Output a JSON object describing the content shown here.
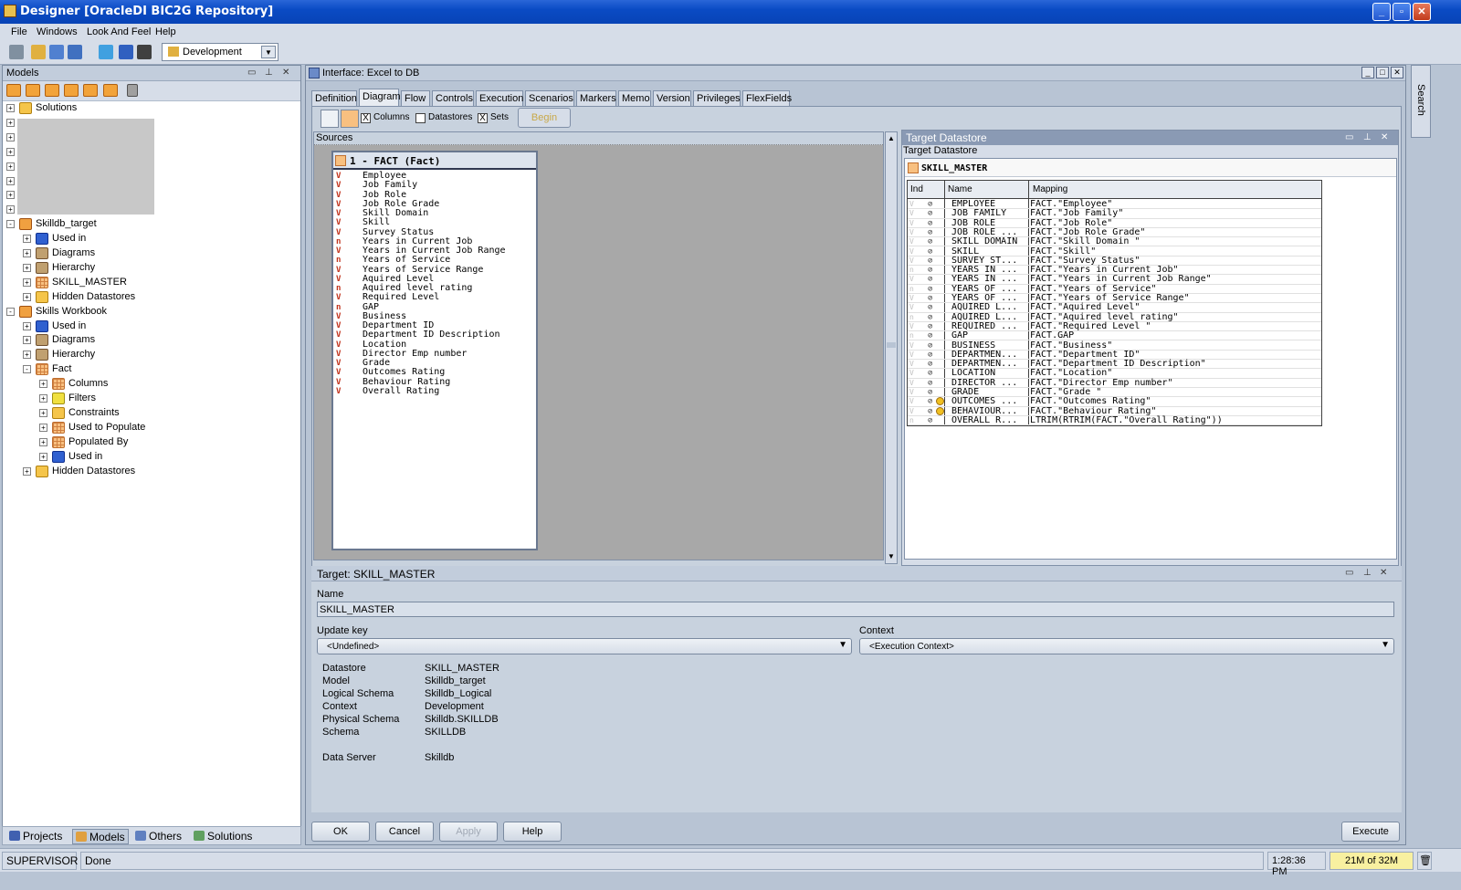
{
  "app": {
    "title": "Designer [OracleDI BIC2G Repository]",
    "window_controls": [
      "_",
      "▫",
      "✕"
    ]
  },
  "menubar": [
    "File",
    "Windows",
    "Look And Feel",
    "Help"
  ],
  "toolbar": {
    "context_combo": "Development"
  },
  "left_panel": {
    "title": "Models",
    "tree": [
      {
        "label": "Solutions",
        "level": 0,
        "icon": "folder-icon",
        "exp": "+"
      },
      {
        "label": "",
        "level": 0,
        "icon": "",
        "exp": "+"
      },
      {
        "label": "",
        "level": 0,
        "icon": "",
        "exp": "+"
      },
      {
        "label": "",
        "level": 0,
        "icon": "",
        "exp": "+"
      },
      {
        "label": "",
        "level": 0,
        "icon": "",
        "exp": "+"
      },
      {
        "label": "",
        "level": 0,
        "icon": "",
        "exp": "+"
      },
      {
        "label": "",
        "level": 0,
        "icon": "",
        "exp": "+"
      },
      {
        "label": "",
        "level": 0,
        "icon": "",
        "exp": "+"
      },
      {
        "label": "Skilldb_target",
        "level": 0,
        "icon": "model-icon",
        "exp": "-"
      },
      {
        "label": "Used in",
        "level": 1,
        "icon": "used-in-icon",
        "exp": "+"
      },
      {
        "label": "Diagrams",
        "level": 1,
        "icon": "diagrams-icon",
        "exp": "+"
      },
      {
        "label": "Hierarchy",
        "level": 1,
        "icon": "hierarchy-icon",
        "exp": "+"
      },
      {
        "label": "SKILL_MASTER",
        "level": 1,
        "icon": "datastore-icon",
        "exp": "+"
      },
      {
        "label": "Hidden Datastores",
        "level": 1,
        "icon": "folder-icon",
        "exp": "+"
      },
      {
        "label": "Skills Workbook",
        "level": 0,
        "icon": "model-icon",
        "exp": "-"
      },
      {
        "label": "Used in",
        "level": 1,
        "icon": "used-in-icon",
        "exp": "+"
      },
      {
        "label": "Diagrams",
        "level": 1,
        "icon": "diagrams-icon",
        "exp": "+"
      },
      {
        "label": "Hierarchy",
        "level": 1,
        "icon": "hierarchy-icon",
        "exp": "+"
      },
      {
        "label": "Fact",
        "level": 1,
        "icon": "datastore-icon",
        "exp": "-"
      },
      {
        "label": "Columns",
        "level": 2,
        "icon": "columns-icon",
        "exp": "+"
      },
      {
        "label": "Filters",
        "level": 2,
        "icon": "filter-icon",
        "exp": "+"
      },
      {
        "label": "Constraints",
        "level": 2,
        "icon": "constraints-icon",
        "exp": "+"
      },
      {
        "label": "Used to Populate",
        "level": 2,
        "icon": "datastore-icon",
        "exp": "+"
      },
      {
        "label": "Populated By",
        "level": 2,
        "icon": "datastore-icon",
        "exp": "+"
      },
      {
        "label": "Used in",
        "level": 2,
        "icon": "used-in-icon",
        "exp": "+"
      },
      {
        "label": "Hidden Datastores",
        "level": 1,
        "icon": "folder-icon",
        "exp": "+"
      }
    ],
    "bottom_tabs": [
      "Projects",
      "Models",
      "Others",
      "Solutions"
    ]
  },
  "interface": {
    "title": "Interface: Excel to DB",
    "tabs": [
      "Definition",
      "Diagram",
      "Flow",
      "Controls",
      "Execution",
      "Scenarios",
      "Markers",
      "Memo",
      "Version",
      "Privileges",
      "FlexFields"
    ],
    "active_tab": "Diagram",
    "diagram_toolbar": {
      "columns_label": "Columns",
      "datastores_label": "Datastores",
      "sets_label": "Sets",
      "begin_label": "Begin",
      "columns_checked": "X",
      "sets_checked": "X"
    },
    "sources_label": "Sources",
    "source_box": {
      "title": "1 - FACT (Fact)",
      "columns": [
        {
          "type": "V",
          "name": "Employee"
        },
        {
          "type": "V",
          "name": "Job Family"
        },
        {
          "type": "V",
          "name": "Job Role"
        },
        {
          "type": "V",
          "name": "Job Role Grade"
        },
        {
          "type": "V",
          "name": "Skill Domain"
        },
        {
          "type": "V",
          "name": "Skill"
        },
        {
          "type": "V",
          "name": "Survey Status"
        },
        {
          "type": "n",
          "name": "Years in Current Job"
        },
        {
          "type": "V",
          "name": "Years in Current Job Range"
        },
        {
          "type": "n",
          "name": "Years of Service"
        },
        {
          "type": "V",
          "name": "Years of Service Range"
        },
        {
          "type": "V",
          "name": "Aquired Level"
        },
        {
          "type": "n",
          "name": "Aquired level rating"
        },
        {
          "type": "V",
          "name": "Required Level"
        },
        {
          "type": "n",
          "name": "GAP"
        },
        {
          "type": "V",
          "name": "Business"
        },
        {
          "type": "V",
          "name": "Department ID"
        },
        {
          "type": "V",
          "name": "Department ID Description"
        },
        {
          "type": "V",
          "name": "Location"
        },
        {
          "type": "V",
          "name": "Director Emp number"
        },
        {
          "type": "V",
          "name": "Grade"
        },
        {
          "type": "V",
          "name": "Outcomes Rating"
        },
        {
          "type": "V",
          "name": "Behaviour Rating"
        },
        {
          "type": "V",
          "name": "Overall Rating"
        }
      ]
    },
    "target_datastore": {
      "panel_title": "Target Datastore",
      "sub_label": "Target Datastore",
      "name": "SKILL_MASTER",
      "headers": {
        "ind": "Ind",
        "name": "Name",
        "mapping": "Mapping"
      },
      "rows": [
        {
          "ind": "V",
          "name": "EMPLOYEE",
          "mapping": "FACT.\"Employee\"",
          "warn": false
        },
        {
          "ind": "V",
          "name": "JOB FAMILY",
          "mapping": "FACT.\"Job Family\"",
          "warn": false
        },
        {
          "ind": "V",
          "name": "JOB ROLE",
          "mapping": "FACT.\"Job Role\"",
          "warn": false
        },
        {
          "ind": "V",
          "name": "JOB ROLE ...",
          "mapping": "FACT.\"Job Role Grade\"",
          "warn": false
        },
        {
          "ind": "V",
          "name": "SKILL DOMAIN",
          "mapping": "FACT.\"Skill Domain \"",
          "warn": false
        },
        {
          "ind": "V",
          "name": "SKILL",
          "mapping": "FACT.\"Skill\"",
          "warn": false
        },
        {
          "ind": "V",
          "name": "SURVEY ST...",
          "mapping": "FACT.\"Survey Status\"",
          "warn": false
        },
        {
          "ind": "n",
          "name": "YEARS IN ...",
          "mapping": "FACT.\"Years in Current Job\"",
          "warn": false
        },
        {
          "ind": "V",
          "name": "YEARS IN ...",
          "mapping": "FACT.\"Years in Current Job Range\"",
          "warn": false
        },
        {
          "ind": "n",
          "name": "YEARS OF ...",
          "mapping": "FACT.\"Years of Service\"",
          "warn": false
        },
        {
          "ind": "V",
          "name": "YEARS OF ...",
          "mapping": "FACT.\"Years of Service Range\"",
          "warn": false
        },
        {
          "ind": "V",
          "name": "AQUIRED L...",
          "mapping": "FACT.\"Aquired Level\"",
          "warn": false
        },
        {
          "ind": "n",
          "name": "AQUIRED L...",
          "mapping": "FACT.\"Aquired level rating\"",
          "warn": false
        },
        {
          "ind": "V",
          "name": "REQUIRED ...",
          "mapping": "FACT.\"Required Level \"",
          "warn": false
        },
        {
          "ind": "n",
          "name": "GAP",
          "mapping": "FACT.GAP",
          "warn": false
        },
        {
          "ind": "V",
          "name": "BUSINESS",
          "mapping": "FACT.\"Business\"",
          "warn": false
        },
        {
          "ind": "V",
          "name": "DEPARTMEN...",
          "mapping": "FACT.\"Department ID\"",
          "warn": false
        },
        {
          "ind": "V",
          "name": "DEPARTMEN...",
          "mapping": "FACT.\"Department ID Description\"",
          "warn": false
        },
        {
          "ind": "V",
          "name": "LOCATION",
          "mapping": "FACT.\"Location\"",
          "warn": false
        },
        {
          "ind": "V",
          "name": "DIRECTOR ...",
          "mapping": "FACT.\"Director Emp number\"",
          "warn": false
        },
        {
          "ind": "V",
          "name": "GRADE",
          "mapping": "FACT.\"Grade \"",
          "warn": false
        },
        {
          "ind": "V",
          "name": "OUTCOMES ...",
          "mapping": "FACT.\"Outcomes Rating\"",
          "warn": true
        },
        {
          "ind": "V",
          "name": "BEHAVIOUR...",
          "mapping": "FACT.\"Behaviour Rating\"",
          "warn": true
        },
        {
          "ind": "n",
          "name": "OVERALL R...",
          "mapping": "LTRIM(RTRIM(FACT.\"Overall Rating\"))",
          "warn": false
        }
      ]
    },
    "target_props": {
      "title": "Target: SKILL_MASTER",
      "name_label": "Name",
      "name_value": "SKILL_MASTER",
      "update_key_label": "Update key",
      "update_key_value": "<Undefined>",
      "context_label": "Context",
      "context_value": "<Execution Context>",
      "info": [
        {
          "k": "Datastore",
          "v": "SKILL_MASTER"
        },
        {
          "k": "Model",
          "v": "Skilldb_target"
        },
        {
          "k": "Logical Schema",
          "v": "Skilldb_Logical"
        },
        {
          "k": "Context",
          "v": "Development"
        },
        {
          "k": "Physical Schema",
          "v": "Skilldb.SKILLDB"
        },
        {
          "k": "Schema",
          "v": "SKILLDB"
        },
        {
          "k": "",
          "v": ""
        },
        {
          "k": "Data Server",
          "v": "Skilldb"
        }
      ]
    },
    "buttons": {
      "ok": "OK",
      "cancel": "Cancel",
      "apply": "Apply",
      "help": "Help",
      "execute": "Execute"
    }
  },
  "right_strip": {
    "label": "Search"
  },
  "statusbar": {
    "user": "SUPERVISOR",
    "status": "Done",
    "time": "1:28:36 PM",
    "memory": "21M of 32M"
  }
}
